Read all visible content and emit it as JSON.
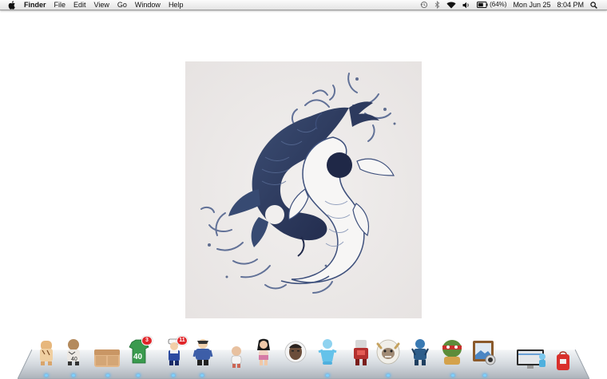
{
  "menubar": {
    "app_name": "Finder",
    "menus": [
      "File",
      "Edit",
      "View",
      "Go",
      "Window",
      "Help"
    ],
    "status": {
      "battery_text": "(64%)",
      "date": "Mon Jun 25",
      "time": "8:04 PM"
    }
  },
  "desktop": {
    "image_name": "koi-yin-yang-ink-drawing"
  },
  "dock": {
    "items": [
      {
        "name": "dock-tiger-figure-icon"
      },
      {
        "name": "dock-dog-lion-figure-icon"
      },
      {
        "name": "dock-tan-box-icon"
      },
      {
        "name": "dock-green-jersey-icon",
        "jersey_text": "40"
      },
      {
        "name": "dock-sailor-figure-icon",
        "badge": "3"
      },
      {
        "name": "dock-samurai-figure-icon",
        "badge": "11"
      },
      {
        "name": "dock-small-figure-icon"
      },
      {
        "name": "dock-woman-figure-icon"
      },
      {
        "name": "dock-face-portrait-icon"
      },
      {
        "name": "dock-blue-figure-icon"
      },
      {
        "name": "dock-red-robot-icon"
      },
      {
        "name": "dock-yeti-figure-icon"
      },
      {
        "name": "dock-blue-warrior-icon"
      },
      {
        "name": "dock-green-turtle-icon"
      },
      {
        "name": "dock-photo-frame-icon"
      },
      {
        "name": "dock-monitor-icon"
      },
      {
        "name": "dock-blue-small-icon"
      },
      {
        "name": "dock-red-bag-icon"
      }
    ]
  }
}
